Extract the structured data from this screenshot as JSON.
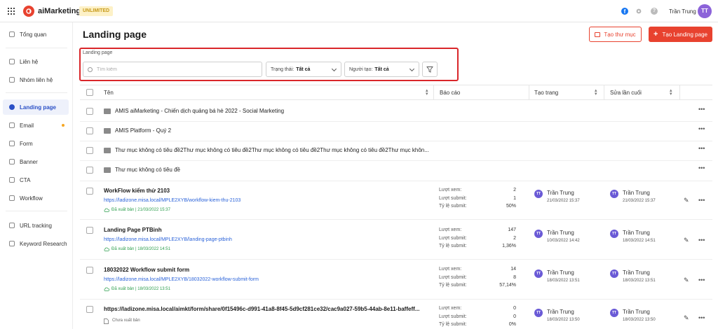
{
  "app": {
    "logo_text": "aiMarketing",
    "plan_badge": "UNLIMITED",
    "user_name": "Trần Trung",
    "user_initials": "TT"
  },
  "sidebar": {
    "items": [
      {
        "label": "Tổng quan"
      },
      {
        "label": "Liên hệ"
      },
      {
        "label": "Nhóm liên hệ"
      },
      {
        "label": "Landing page"
      },
      {
        "label": "Email"
      },
      {
        "label": "Form"
      },
      {
        "label": "Banner"
      },
      {
        "label": "CTA"
      },
      {
        "label": "Workflow"
      },
      {
        "label": "URL tracking"
      },
      {
        "label": "Keyword Research"
      }
    ]
  },
  "header": {
    "title": "Landing page",
    "create_folder_label": "Tạo thư mục",
    "create_landing_label": "Tạo Landing page"
  },
  "filters": {
    "section_label": "Landing page",
    "search_placeholder": "Tìm kiếm",
    "status_label": "Trạng thái:",
    "status_value": "Tất cả",
    "creator_label": "Người tạo:",
    "creator_value": "Tất cả"
  },
  "table": {
    "columns": [
      "Tên",
      "Báo cáo",
      "Tạo trang",
      "Sửa lần cuối"
    ],
    "folders": [
      {
        "name": "AMIS aiMarketing - Chiến dịch quảng bá hè 2022 - Social Marketing"
      },
      {
        "name": "AMIS Platform - Quý 2"
      },
      {
        "name": "Thư mục không có tiêu đề2Thư mục không có tiêu đề2Thư mục không có tiêu đề2Thư mục không có tiêu đề2Thư mục khôn..."
      },
      {
        "name": "Thư mục không có tiêu đề"
      }
    ],
    "stat_labels": [
      "Lượt xem:",
      "Lượt submit:",
      "Tỷ lệ submit:"
    ],
    "pages": [
      {
        "title": "WorkFlow kiểm thử 2103",
        "url": "https://ladizone.misa.local/MPLE2XYB/workflow-kiem-thu-2103",
        "status": "Đã xuất bản | 21/03/2022 15:37",
        "views": "2",
        "submits": "1",
        "rate": "50%",
        "created_by": "Trần Trung",
        "created_at": "21/03/2022 15:37",
        "edited_by": "Trần Trung",
        "edited_at": "21/03/2022 15:37"
      },
      {
        "title": "Landing Page PTBinh",
        "url": "https://ladizone.misa.local/MPLE2XYB/landing-page-ptbinh",
        "status": "Đã xuất bản | 18/03/2022 14:51",
        "views": "147",
        "submits": "2",
        "rate": "1,36%",
        "created_by": "Trần Trung",
        "created_at": "10/03/2022 14:42",
        "edited_by": "Trần Trung",
        "edited_at": "18/03/2022 14:51"
      },
      {
        "title": "18032022 Workflow submit form",
        "url": "https://ladizone.misa.local/MPLE2XYB/18032022-workflow-submit-form",
        "status": "Đã xuất bản | 18/03/2022 13:51",
        "views": "14",
        "submits": "8",
        "rate": "57,14%",
        "created_by": "Trần Trung",
        "created_at": "18/03/2022 13:51",
        "edited_by": "Trần Trung",
        "edited_at": "18/03/2022 13:51"
      },
      {
        "title": "https://ladizone.misa.local/aimkt/form/share/0f15496c-d991-41a8-8f45-5d9cf281ce32/cac9a027-59b5-44ab-8e11-baffeff...",
        "url": "",
        "status": "Chưa xuất bản",
        "views": "0",
        "submits": "0",
        "rate": "0%",
        "created_by": "Trần Trung",
        "created_at": "18/03/2022 13:50",
        "edited_by": "Trần Trung",
        "edited_at": "18/03/2022 13:50"
      }
    ]
  },
  "colors": {
    "accent": "#e8422f",
    "link": "#2b63d9",
    "active_nav": "#2b50c6",
    "published": "#2a9d4b",
    "avatar": "#8c63d9",
    "highlight_border": "#d9262a"
  }
}
